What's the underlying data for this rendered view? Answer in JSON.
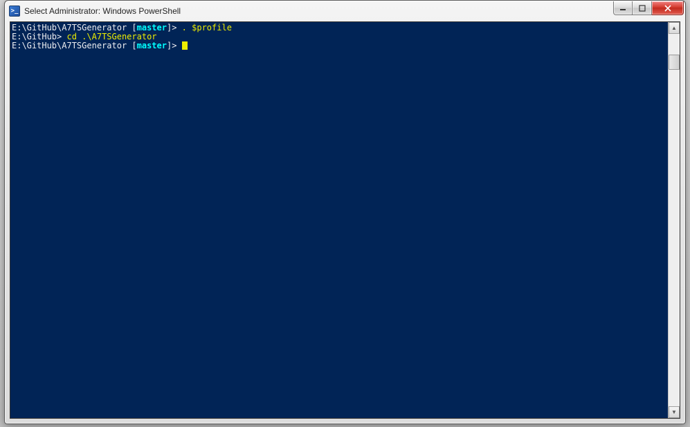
{
  "window": {
    "title": "Select Administrator: Windows PowerShell"
  },
  "console": {
    "lines": [
      {
        "path": "E:\\GitHub\\A7TSGenerator ",
        "branch_open": "[",
        "branch": "master",
        "branch_close": "]",
        "prompt_end": ">",
        "cmd": " . $profile"
      },
      {
        "path": "E:\\GitHub",
        "prompt_end": ">",
        "cmd": " cd .\\A7TSGenerator"
      },
      {
        "path": "E:\\GitHub\\A7TSGenerator ",
        "branch_open": "[",
        "branch": "master",
        "branch_close": "]",
        "prompt_end": ">",
        "cmd": " ",
        "cursor": true
      }
    ]
  },
  "colors": {
    "console_bg": "#012456",
    "prompt": "#eeedf0",
    "command": "#eeed00",
    "branch": "#00ffff"
  }
}
